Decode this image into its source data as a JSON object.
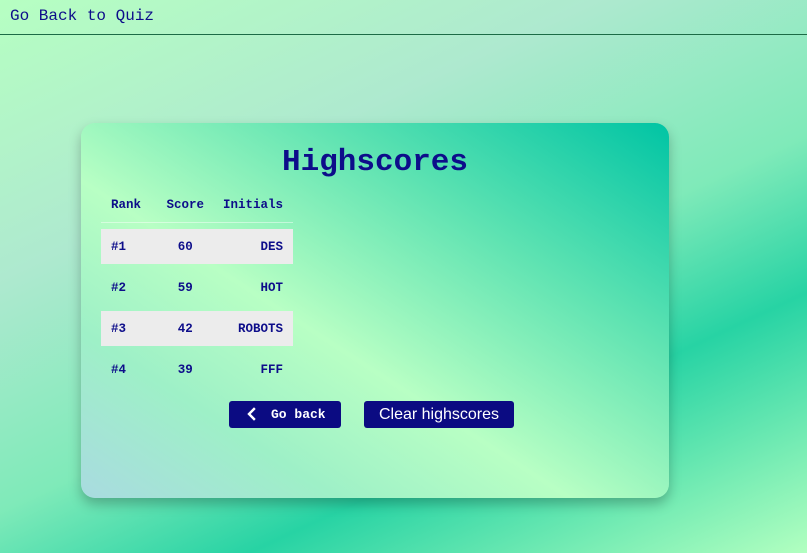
{
  "nav": {
    "back_to_quiz_label": "Go Back to Quiz"
  },
  "card": {
    "title": "Highscores",
    "table": {
      "headers": [
        "Rank",
        "Score",
        "Initials"
      ],
      "rows": [
        {
          "rank": "#1",
          "score": "60",
          "initials": "DES"
        },
        {
          "rank": "#2",
          "score": "59",
          "initials": "HOT"
        },
        {
          "rank": "#3",
          "score": "42",
          "initials": "ROBOTS"
        },
        {
          "rank": "#4",
          "score": "39",
          "initials": "FFF"
        }
      ]
    },
    "buttons": {
      "go_back_label": "Go back",
      "go_back_icon": "chevron-left-icon",
      "clear_label": "Clear highscores"
    }
  },
  "colors": {
    "text": "#0d0d8a",
    "button_bg": "#0b0b82",
    "row_shade": "#ececec"
  }
}
